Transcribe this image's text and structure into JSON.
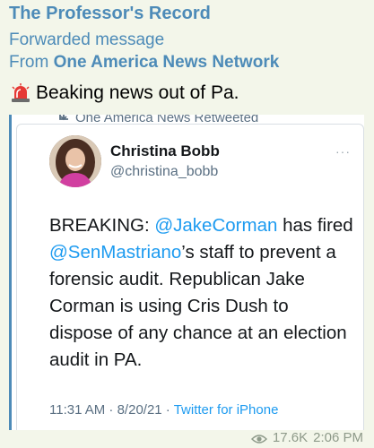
{
  "message": {
    "channel_name": "The Professor's Record",
    "forward_label": "Forwarded message",
    "forward_from_prefix": "From",
    "forward_from_source": "One America News Network",
    "headline": "Beaking news out of Pa.",
    "views": "17.6K",
    "time": "2:06 PM"
  },
  "embed": {
    "retweet_label": "One America News Retweeted",
    "author_name": "Christina Bobb",
    "author_handle": "@christina_bobb",
    "more_label": "···",
    "text_parts": {
      "p1": "BREAKING: ",
      "m1": "@JakeCorman",
      "p2": " has fired ",
      "m2": "@SenMastriano",
      "p3": "’s staff to prevent a forensic audit. Republican Jake Corman is using Cris Dush to dispose of any chance at an election audit in PA."
    },
    "meta_time": "11:31 AM · 8/20/21 · ",
    "meta_source": "Twitter for iPhone"
  },
  "icons": {
    "siren": "siren-icon",
    "retweet": "retweet-icon",
    "views": "eye-icon",
    "more": "more-icon"
  }
}
